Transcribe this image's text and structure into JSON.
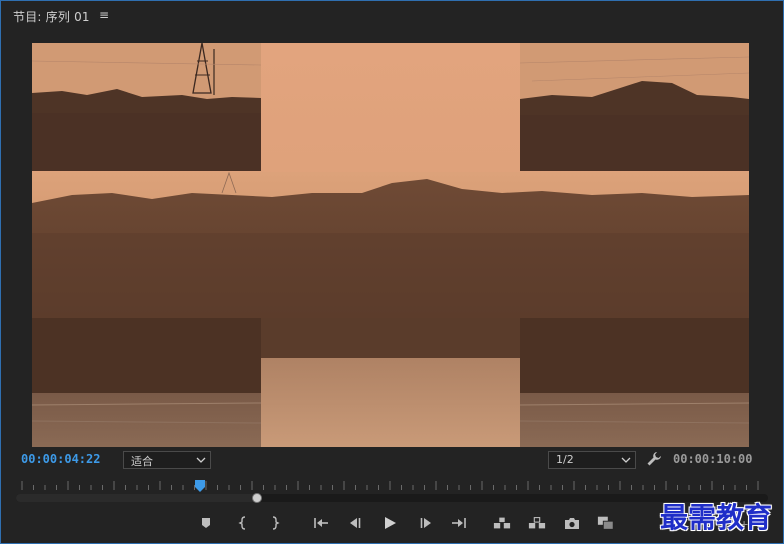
{
  "panel": {
    "title": "节目: 序列 01",
    "menu_icon": "hamburger-menu-icon"
  },
  "playback": {
    "current_timecode": "00:00:04:22",
    "duration_timecode": "00:00:10:00",
    "zoom_select": "适合",
    "resolution_select": "1/2"
  },
  "transport": [
    {
      "name": "add-marker-button",
      "icon": "marker-icon"
    },
    {
      "name": "mark-in-button",
      "icon": "mark-in-icon"
    },
    {
      "name": "mark-out-button",
      "icon": "mark-out-icon"
    },
    {
      "name": "go-to-in-button",
      "icon": "go-to-in-icon"
    },
    {
      "name": "step-back-button",
      "icon": "step-back-icon"
    },
    {
      "name": "play-button",
      "icon": "play-icon"
    },
    {
      "name": "step-forward-button",
      "icon": "step-forward-icon"
    },
    {
      "name": "go-to-out-button",
      "icon": "go-to-out-icon"
    },
    {
      "name": "lift-button",
      "icon": "lift-icon"
    },
    {
      "name": "extract-button",
      "icon": "extract-icon"
    },
    {
      "name": "export-frame-button",
      "icon": "camera-icon"
    },
    {
      "name": "comparison-view-button",
      "icon": "comparison-icon"
    }
  ],
  "colors": {
    "accent": "#3d9ae8",
    "panel_bg": "#232323",
    "frame_border": "#2f6fb0",
    "watermark": "#1f2ec8"
  },
  "watermark": "最需教育"
}
